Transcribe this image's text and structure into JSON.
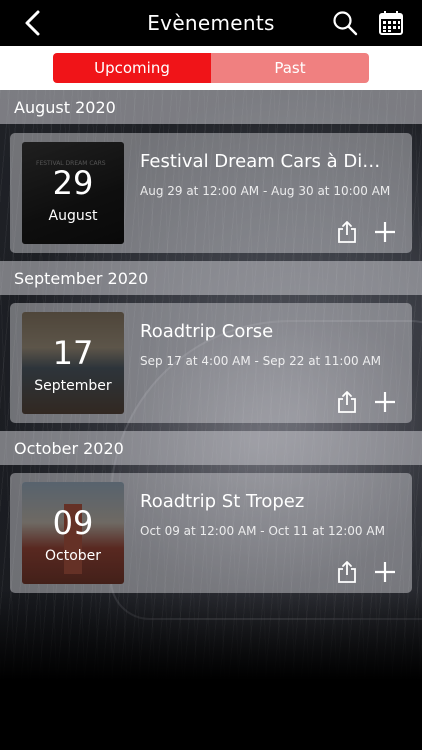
{
  "header": {
    "title": "Evènements",
    "back_icon": "chevron-left-icon",
    "search_icon": "search-icon",
    "calendar_icon": "calendar-icon"
  },
  "tabs": [
    {
      "label": "Upcoming",
      "active": true
    },
    {
      "label": "Past",
      "active": false
    }
  ],
  "colors": {
    "accent": "#f01418",
    "tab_inactive": "#f08080"
  },
  "sections": [
    {
      "month": "August 2020",
      "events": [
        {
          "day": "29",
          "month": "August",
          "title": "Festival Dream Cars à Divo...",
          "dates": "Aug 29 at 12:00 AM - Aug 30 at 10:00 AM",
          "poster_text": "FESTIVAL DREAM CARS"
        }
      ]
    },
    {
      "month": "September 2020",
      "events": [
        {
          "day": "17",
          "month": "September",
          "title": "Roadtrip Corse",
          "dates": "Sep 17 at 4:00 AM - Sep 22 at 11:00 AM"
        }
      ]
    },
    {
      "month": "October 2020",
      "events": [
        {
          "day": "09",
          "month": "October",
          "title": "Roadtrip St Tropez",
          "dates": "Oct 09 at 12:00 AM - Oct 11 at 12:00 AM"
        }
      ]
    }
  ],
  "card_actions": {
    "share_icon": "share-icon",
    "add_icon": "plus-icon"
  }
}
